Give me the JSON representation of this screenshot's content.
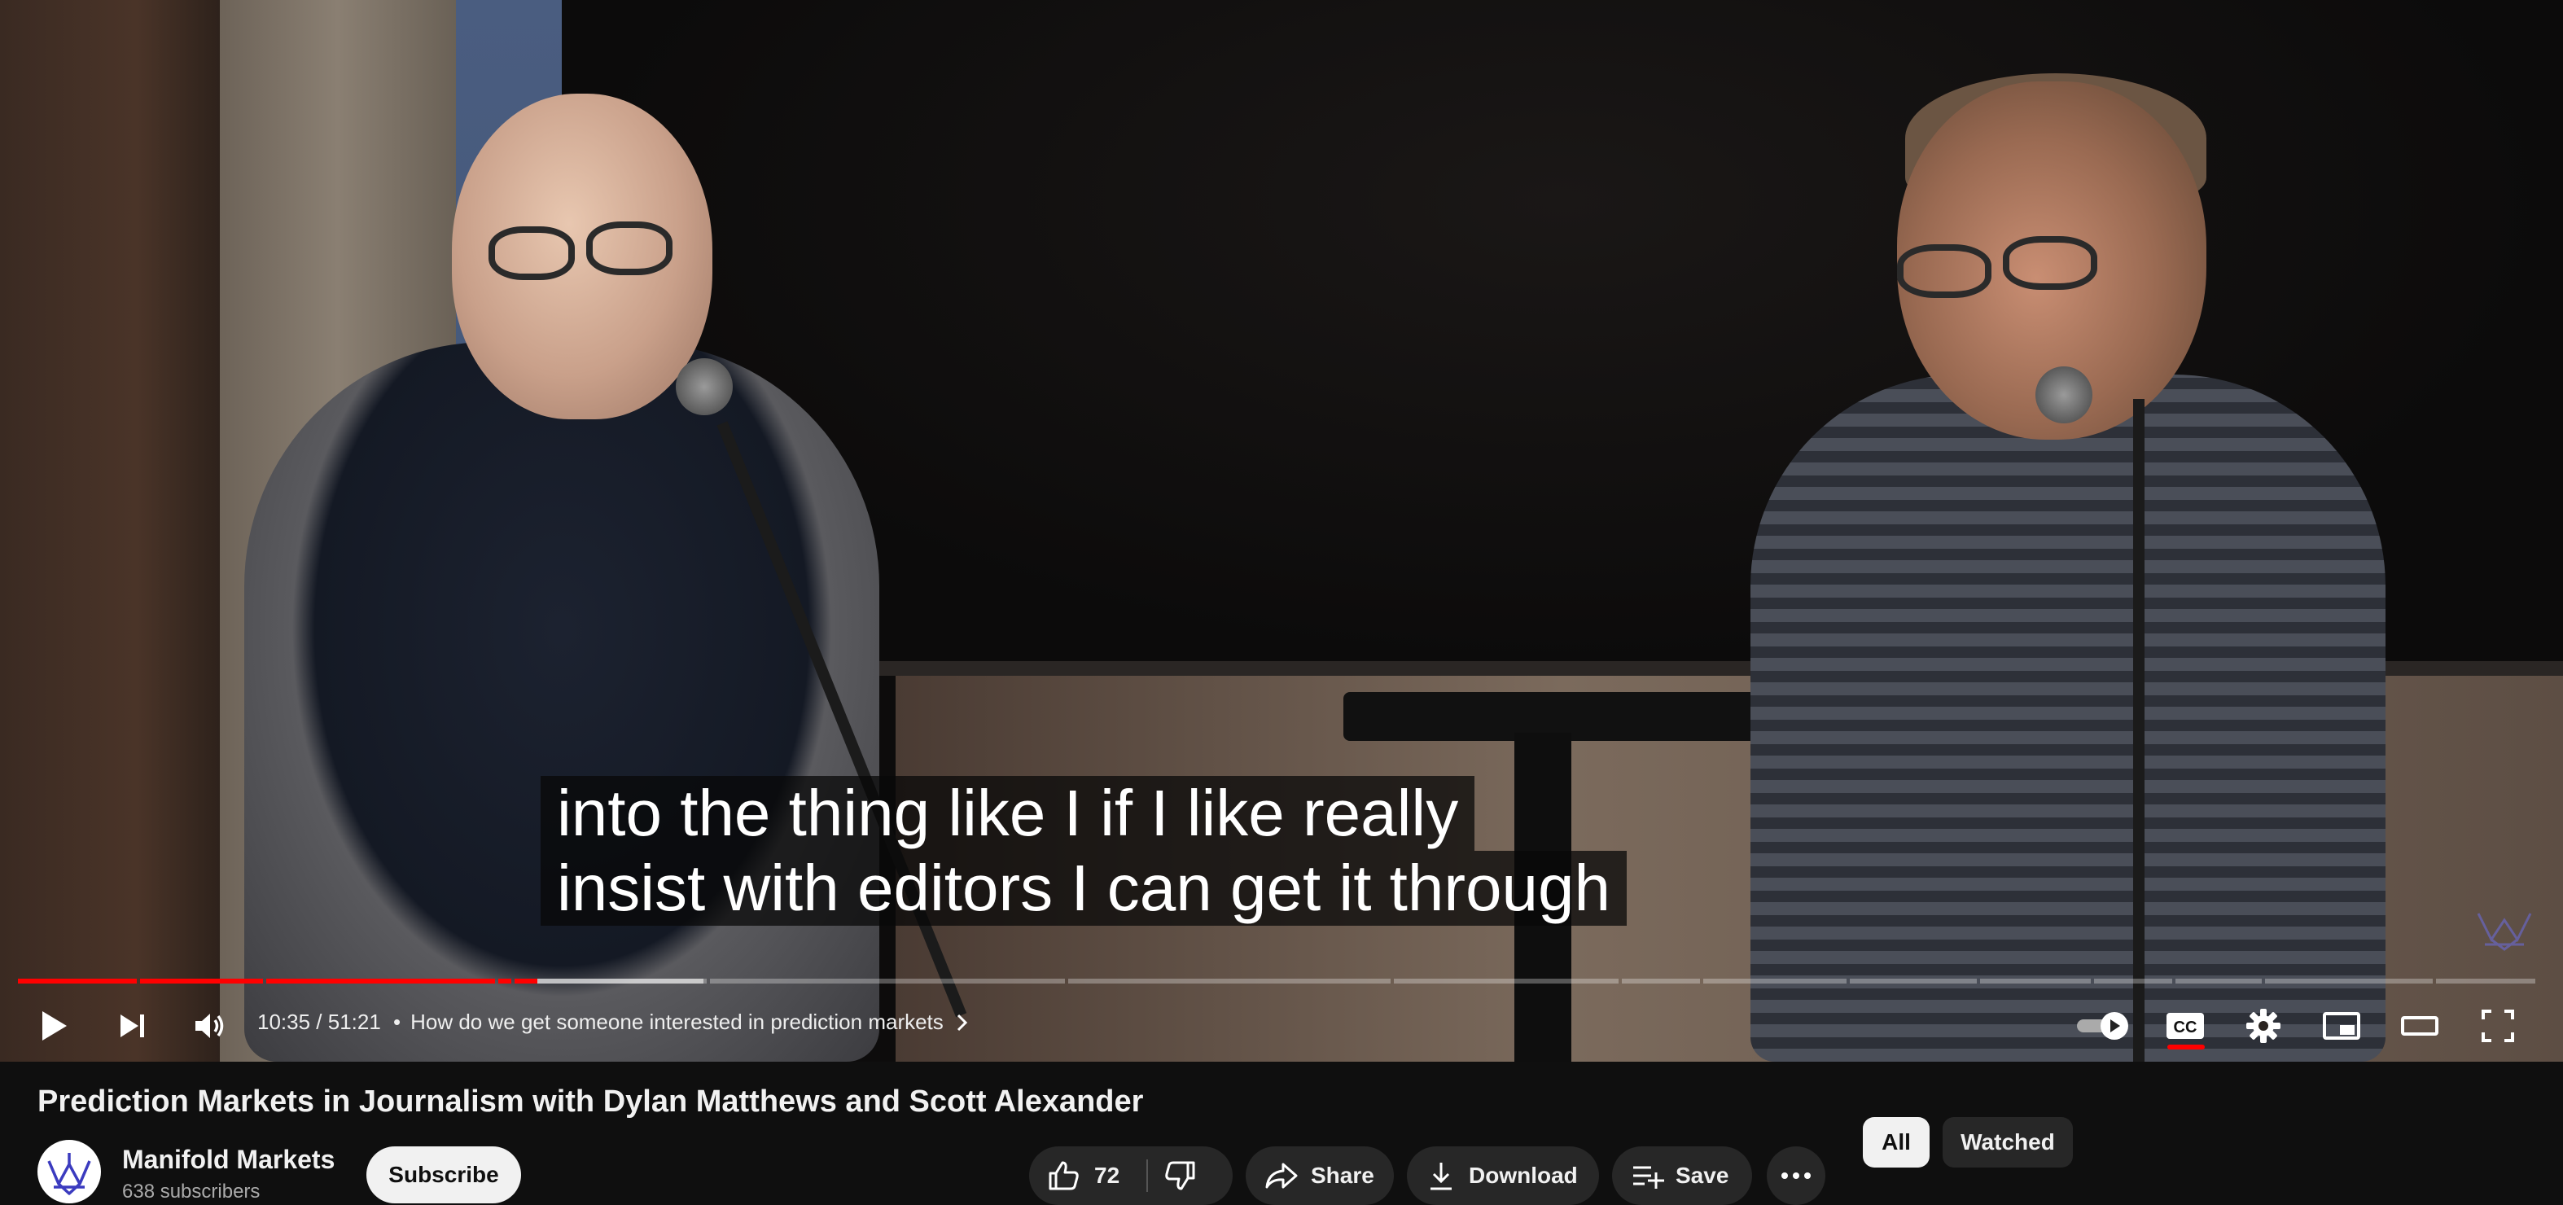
{
  "player": {
    "captions": {
      "line1": "into the thing like I if I like really",
      "line2": "insist with editors I can get it through"
    },
    "time_current": "10:35",
    "time_separator": " / ",
    "time_total": "51:21",
    "chapter_title": "How do we get someone interested in prediction markets",
    "progress_fraction": 0.206,
    "buffered_fraction": 0.272,
    "controls": {
      "play_icon": "play-icon",
      "next_icon": "next-icon",
      "volume_icon": "volume-icon",
      "autoplay_icon": "autoplay-toggle-icon",
      "captions_icon": "cc-icon",
      "settings_icon": "gear-icon",
      "miniplayer_icon": "miniplayer-icon",
      "theater_icon": "theater-icon",
      "fullscreen_icon": "fullscreen-icon"
    }
  },
  "video": {
    "title": "Prediction Markets in Journalism with Dylan Matthews and Scott Alexander"
  },
  "channel": {
    "name": "Manifold Markets",
    "subscribers": "638 subscribers",
    "subscribe_label": "Subscribe"
  },
  "actions": {
    "like_count": "72",
    "share_label": "Share",
    "download_label": "Download",
    "save_label": "Save"
  },
  "filter_chips": {
    "all_label": "All",
    "watched_label": "Watched",
    "active": "All"
  },
  "colors": {
    "accent": "#ff0000",
    "background": "#0f0f0f",
    "pill": "#272727"
  }
}
